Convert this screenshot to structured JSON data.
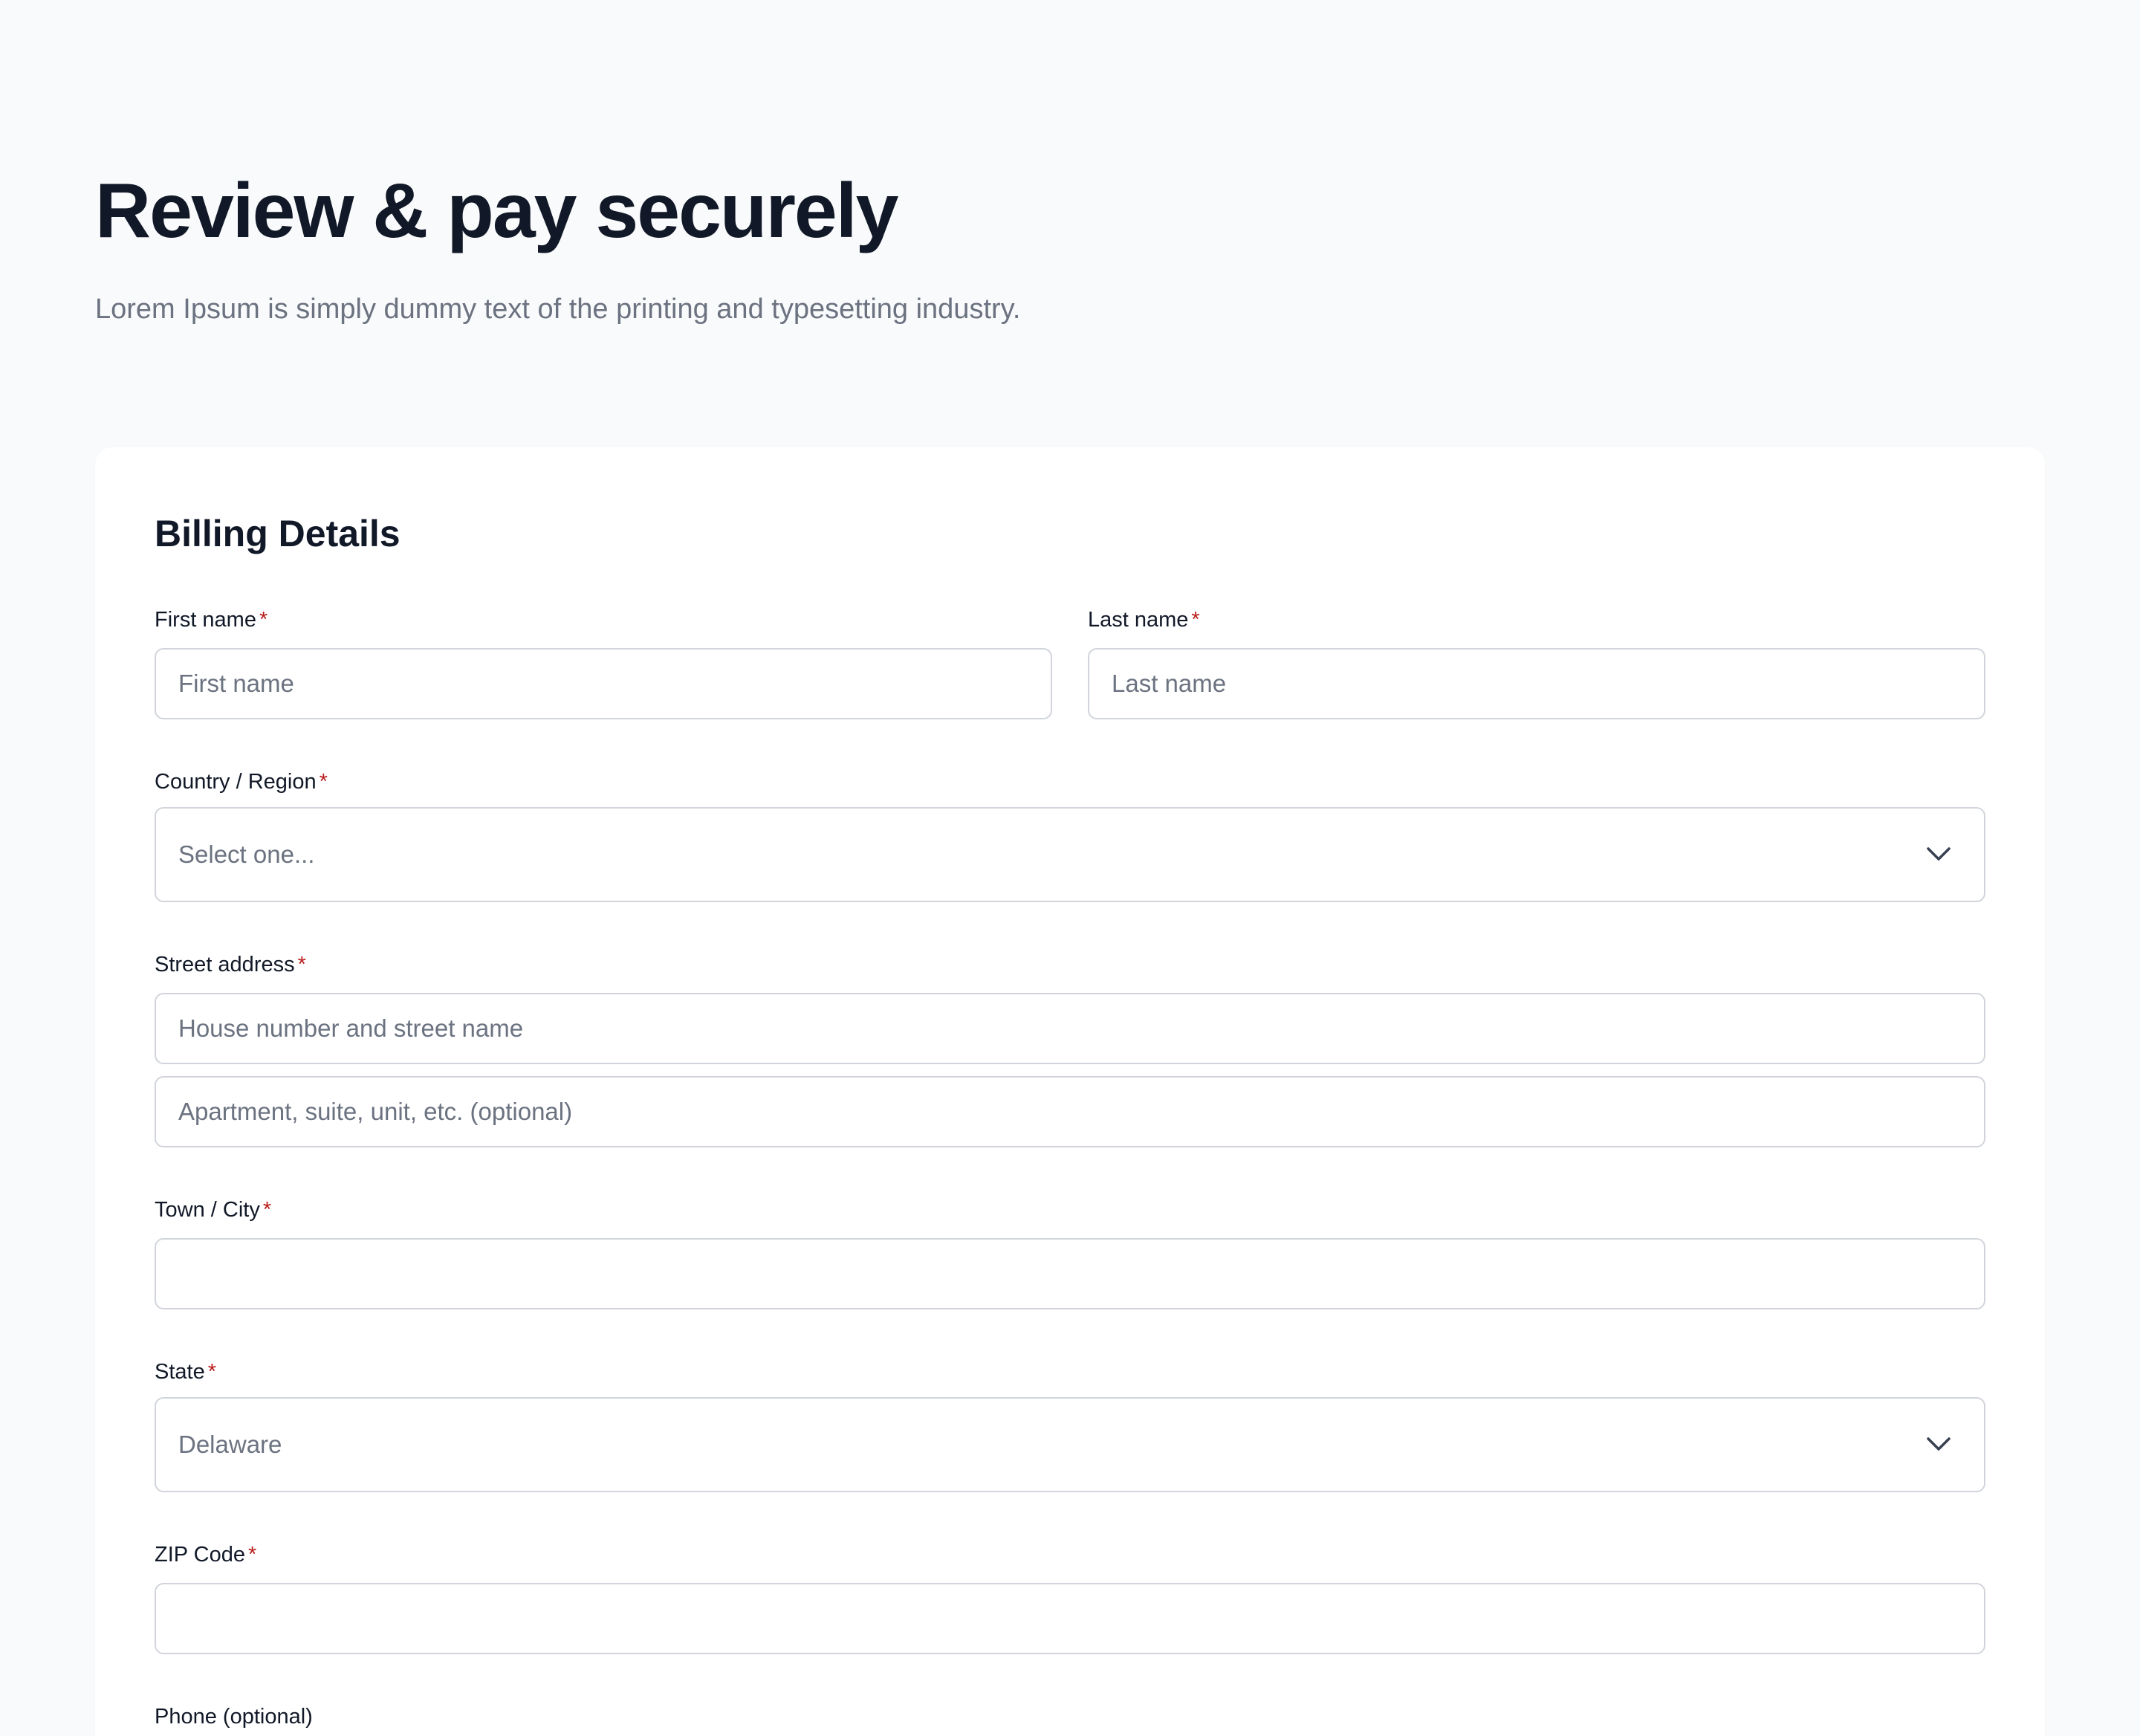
{
  "page": {
    "title": "Review & pay securely",
    "subtitle": "Lorem Ipsum is simply dummy text of the printing and typesetting industry."
  },
  "billing": {
    "section_title": "Billing Details",
    "required_marker": "*",
    "first_name": {
      "label": "First name",
      "placeholder": "First name",
      "value": ""
    },
    "last_name": {
      "label": "Last name",
      "placeholder": "Last name",
      "value": ""
    },
    "country": {
      "label": "Country / Region",
      "selected": "Select one...",
      "icon": "chevron-down-icon"
    },
    "street": {
      "label": "Street address",
      "line1_placeholder": "House number and street name",
      "line2_placeholder": "Apartment, suite, unit, etc. (optional)"
    },
    "city": {
      "label": "Town / City",
      "value": ""
    },
    "state": {
      "label": "State",
      "selected": "Delaware",
      "icon": "chevron-down-icon"
    },
    "zip": {
      "label": "ZIP Code",
      "value": ""
    },
    "phone": {
      "label": "Phone (optional)"
    }
  },
  "colors": {
    "background": "#f9fafb",
    "card": "#ffffff",
    "heading": "#111827",
    "muted_text": "#6b7280",
    "input_border": "#d1d5db",
    "required": "#b91c1c"
  }
}
